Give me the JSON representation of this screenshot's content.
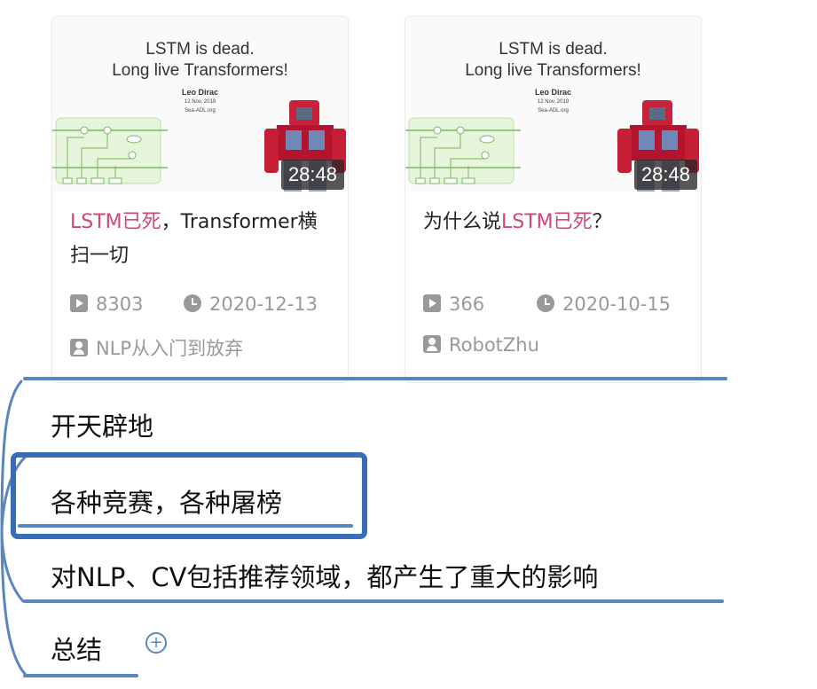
{
  "cards": [
    {
      "thumb": {
        "line1": "LSTM is dead.",
        "line2": "Long live Transformers!",
        "author": "Leo Dirac",
        "date": "12 Nov, 2019",
        "site": "Sea-ADL.org"
      },
      "duration": "28:48",
      "title_hl": "LSTM已死",
      "title_rest": "，Transformer横扫一切",
      "views": "8303",
      "date": "2020-12-13",
      "owner": "NLP从入门到放弃"
    },
    {
      "thumb": {
        "line1": "LSTM is dead.",
        "line2": "Long live Transformers!",
        "author": "Leo Dirac",
        "date": "12 Nov, 2019",
        "site": "Sea-ADL.org"
      },
      "duration": "28:48",
      "title_pre": "为什么说",
      "title_hl": "LSTM已死",
      "title_rest": "？",
      "views": "366",
      "date": "2020-10-15",
      "owner": "RobotZhu"
    }
  ],
  "mindmap": {
    "items": [
      "开天辟地",
      "各种竞赛，各种屠榜",
      "对NLP、CV包括推荐领域，都产生了重大的影响",
      "总结"
    ],
    "expand_symbol": "+",
    "line_color": "#5a86c0",
    "select_color": "#3a6db7"
  },
  "colors": {
    "highlight": "#d4437a",
    "meta": "#999999"
  }
}
